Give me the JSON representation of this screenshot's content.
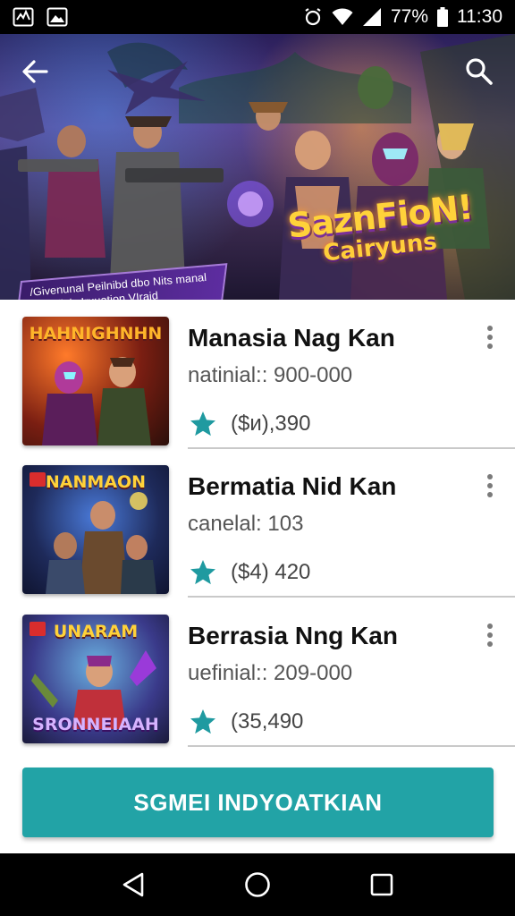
{
  "status_bar": {
    "battery": "77",
    "time": "11:30",
    "icons": [
      "activity-icon",
      "image-icon",
      "alarm-icon",
      "wifi-icon",
      "signal-icon",
      "battery-icon"
    ]
  },
  "hero": {
    "back_icon": "arrow-left-icon",
    "search_icon": "search-icon",
    "title_line1": "SaznFioN!",
    "title_line2": "Cairyuns",
    "banner_line1": "/Givenunal Peilnibd dbo Nits manal",
    "banner_line2": "Pegadlejy Iruuation VIraid"
  },
  "games": [
    {
      "thumb_title": "HAHNIGHNHN",
      "title": "Manasia Nag Kan",
      "subtitle": "natinial:: 900-000",
      "rating": "($и),390"
    },
    {
      "thumb_title": "NANMAON",
      "title": "Bermatia Nid Kan",
      "subtitle": "canelal: 103",
      "rating": "($4) 420"
    },
    {
      "thumb_title": "UNARAM",
      "thumb_bottom": "SRONNEIAAH",
      "title": "Berrasia Nng Kan",
      "subtitle": "uefinial:: 209-000",
      "rating": "(35,490"
    }
  ],
  "cta": {
    "label": "SGMEI INDYOATKIAN"
  },
  "nav": {
    "icons": [
      "back-triangle-icon",
      "home-circle-icon",
      "recents-square-icon"
    ]
  },
  "colors": {
    "accent": "#22a3a6",
    "star": "#1f9aa0"
  }
}
